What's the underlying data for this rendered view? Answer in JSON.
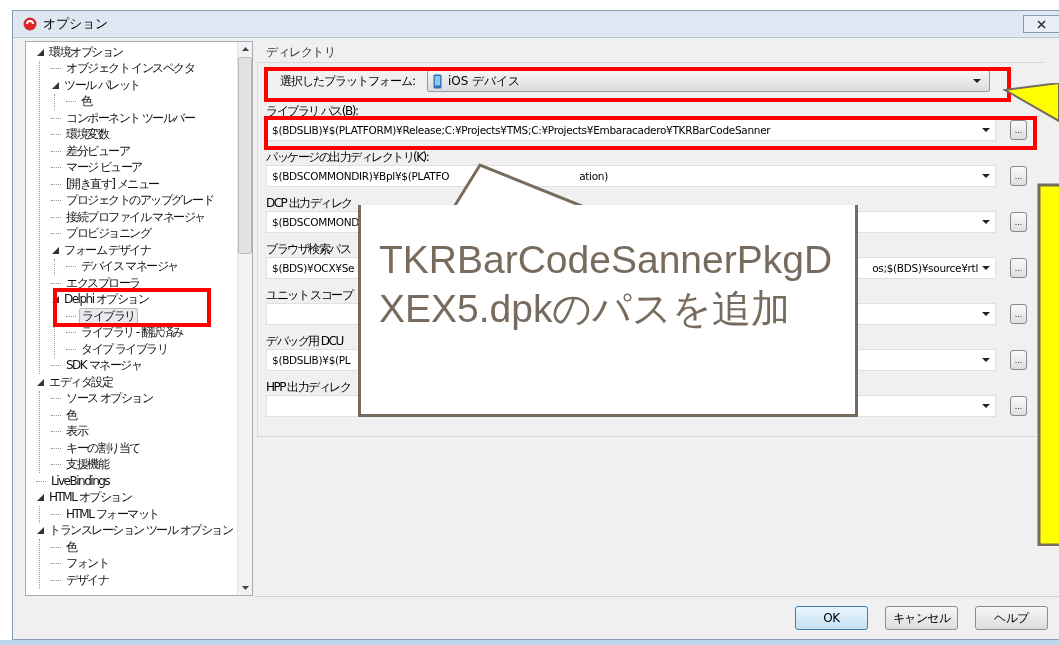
{
  "window": {
    "title": "オプション"
  },
  "tree": [
    {
      "label": "環境オプション",
      "expanded": true,
      "selected": false,
      "children": [
        {
          "label": "オブジェクト インスペクタ",
          "selected": false
        },
        {
          "label": "ツール パレット",
          "expanded": true,
          "selected": false,
          "children": [
            {
              "label": "色",
              "selected": false
            }
          ]
        },
        {
          "label": "コンポーネント ツールバー",
          "selected": false
        },
        {
          "label": "環境変数",
          "selected": false
        },
        {
          "label": "差分ビューア",
          "selected": false
        },
        {
          "label": "マージ ビューア",
          "selected": false
        },
        {
          "label": "[開き直す] メニュー",
          "selected": false
        },
        {
          "label": "プロジェクトのアップグレード",
          "selected": false
        },
        {
          "label": "接続プロファイル マネージャ",
          "selected": false
        },
        {
          "label": "プロビジョニング",
          "selected": false
        },
        {
          "label": "フォーム デザイナ",
          "expanded": true,
          "selected": false,
          "children": [
            {
              "label": "デバイス マネージャ",
              "selected": false
            }
          ]
        },
        {
          "label": "エクスプローラ",
          "selected": false
        },
        {
          "label": "Delphi オプション",
          "expanded": true,
          "selected": false,
          "children": [
            {
              "label": "ライブラリ",
              "selected": true
            },
            {
              "label": "ライブラリ - 翻訳済み",
              "selected": false
            },
            {
              "label": "タイプ ライブラリ",
              "selected": false
            }
          ]
        },
        {
          "label": "SDK マネージャ",
          "selected": false
        }
      ]
    },
    {
      "label": "エディタ設定",
      "expanded": true,
      "selected": false,
      "children": [
        {
          "label": "ソース オプション",
          "selected": false
        },
        {
          "label": "色",
          "selected": false
        },
        {
          "label": "表示",
          "selected": false
        },
        {
          "label": "キーの割り当て",
          "selected": false
        },
        {
          "label": "支援機能",
          "selected": false
        }
      ]
    },
    {
      "label": "LiveBindings",
      "selected": false
    },
    {
      "label": "HTML オプション",
      "expanded": true,
      "selected": false,
      "children": [
        {
          "label": "HTML フォーマット",
          "selected": false
        }
      ]
    },
    {
      "label": "トランスレーション ツール オプション",
      "expanded": true,
      "selected": false,
      "children": [
        {
          "label": "色",
          "selected": false
        },
        {
          "label": "フォント",
          "selected": false
        },
        {
          "label": "デザイナ",
          "selected": false
        }
      ]
    }
  ],
  "group": {
    "title": "ディレクトリ",
    "platform_label": "選択したプラットフォーム:",
    "platform": "iOS デバイス"
  },
  "fields": [
    {
      "label": "ライブラリ パス(B):",
      "value": "$(BDSLIB)¥$(PLATFORM)¥Release;C:¥Projects¥TMS;C:¥Projects¥Embaracadero¥TKRBarCodeSanner",
      "button": "..."
    },
    {
      "label": "パッケージの出力ディレクトリ(K):",
      "value": "$(BDSCOMMONDIR)¥Bpl¥$(PLATFO",
      "value_mid": "ation)",
      "button": "..."
    },
    {
      "label": "DCP 出力ディレク",
      "value": "$(BDSCOMMOND",
      "button": "..."
    },
    {
      "label": "ブラウザ検索パス",
      "value": "$(BDS)¥OCX¥Se",
      "value_end": "os;$(BDS)¥source¥rtl",
      "button": "..."
    },
    {
      "label": "ユニット スコープ",
      "button": "..."
    },
    {
      "label": "デバッグ用 DCU",
      "value": "$(BDSLIB)¥$(PL",
      "button": "..."
    },
    {
      "label": "HPP 出力ディレク",
      "button": "..."
    }
  ],
  "buttons": [
    {
      "label": "OK",
      "default": true
    },
    {
      "label": "キャンセル",
      "default": false
    },
    {
      "label": "ヘルプ",
      "default": false
    }
  ],
  "callout": {
    "text": "TKRBarCodeSannerPkgDXEX5.dpkのパスを追加"
  }
}
